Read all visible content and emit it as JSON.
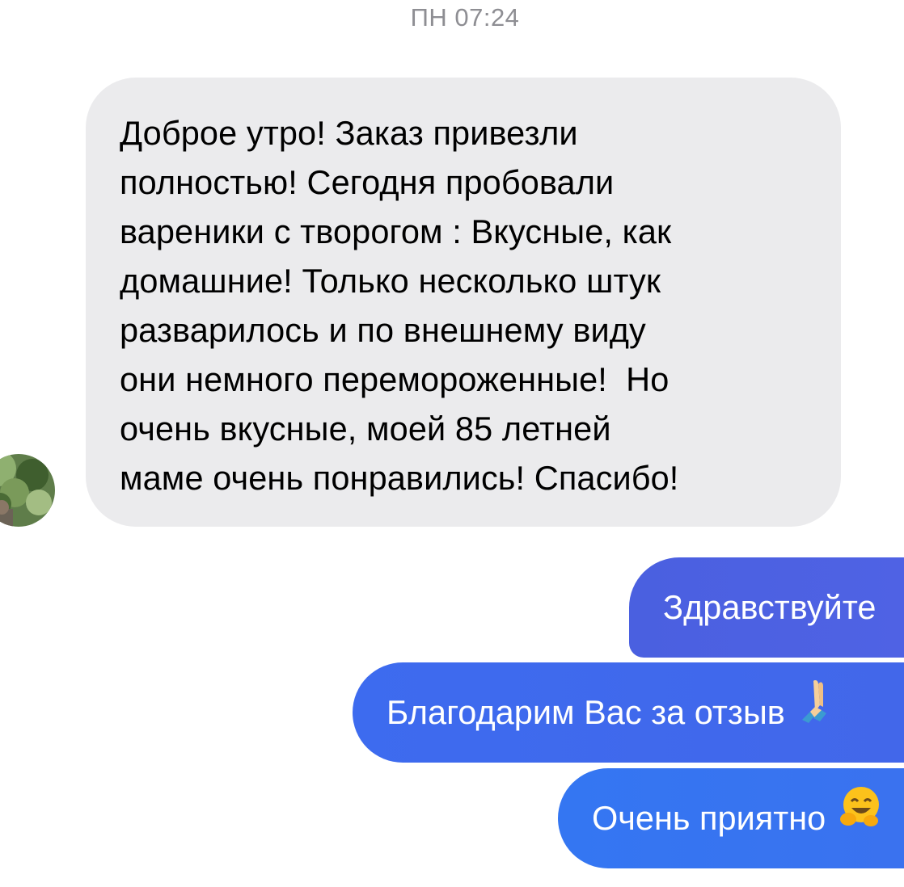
{
  "chat": {
    "timestamp": "ПН 07:24",
    "incoming": {
      "lines": [
        "Доброе утро! Заказ привезли",
        "полностью! Сегодня пробовали",
        "вареники с творогом : Вкусные, как",
        "домашние! Только несколько штук",
        "разварилось и по внешнему виду",
        "они немного перемороженные!  Но",
        "очень вкусные, моей 85 летней",
        "маме очень понравились! Спасибо!"
      ]
    },
    "outgoing": [
      {
        "text": "Здравствуйте"
      },
      {
        "text": "Благодарим Вас за отзыв",
        "emoji": "folded-hands-icon"
      },
      {
        "text": "Очень приятно",
        "emoji": "hugging-face-icon"
      }
    ]
  },
  "colors": {
    "incoming_bubble": "#ebebed",
    "outgoing_bubble_top": "#4a60e0",
    "outgoing_bubble_middle": "#3d6bef",
    "outgoing_bubble_bottom": "#3476f2",
    "timestamp_text": "#8e8e93"
  }
}
